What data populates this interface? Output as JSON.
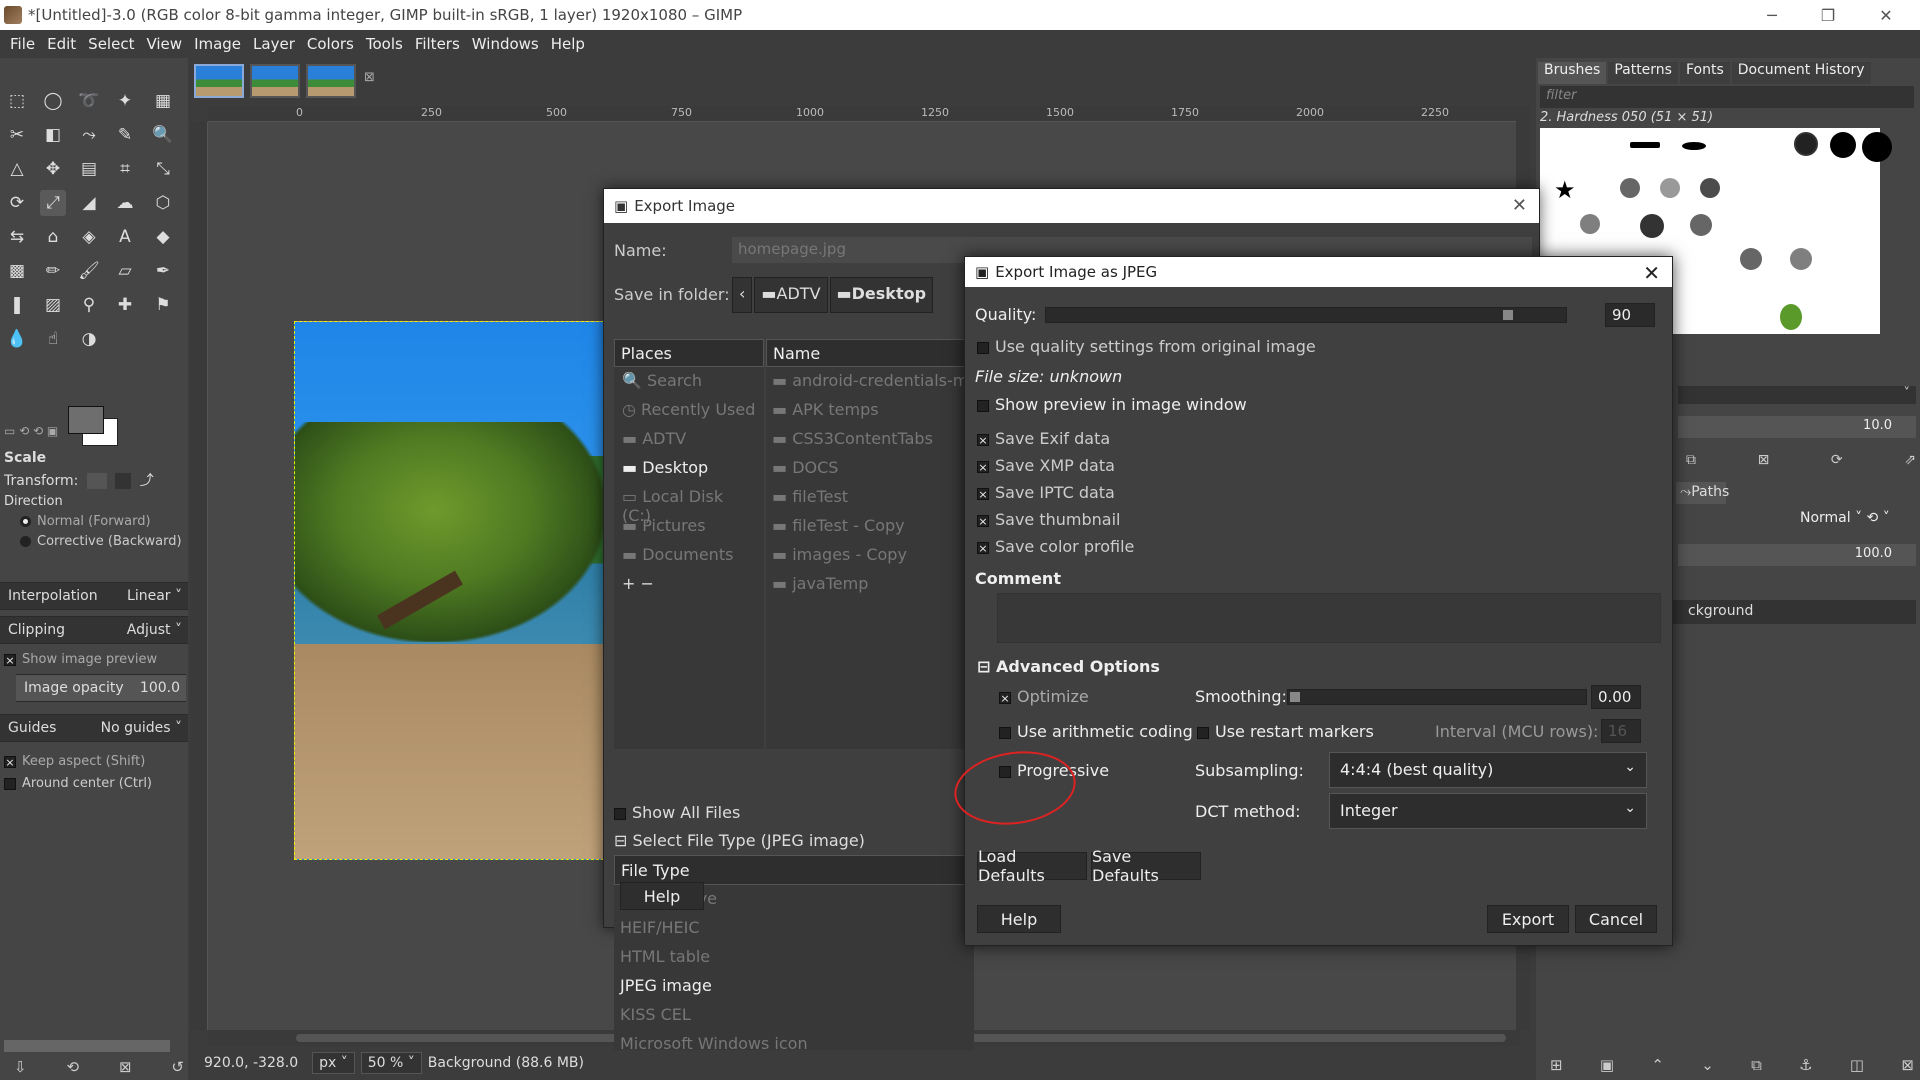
{
  "window": {
    "title": "*[Untitled]-3.0 (RGB color 8-bit gamma integer, GIMP built-in sRGB, 1 layer) 1920x1080 – GIMP"
  },
  "menu": [
    "File",
    "Edit",
    "Select",
    "View",
    "Image",
    "Layer",
    "Colors",
    "Tools",
    "Filters",
    "Windows",
    "Help"
  ],
  "tool_options": {
    "title": "Scale",
    "transform_label": "Transform:",
    "direction_label": "Direction",
    "direction_normal": "Normal (Forward)",
    "direction_corrective": "Corrective (Backward)",
    "interpolation_label": "Interpolation",
    "interpolation_value": "Linear",
    "clipping_label": "Clipping",
    "clipping_value": "Adjust",
    "show_preview": "Show image preview",
    "image_opacity_label": "Image opacity",
    "image_opacity_value": "100.0",
    "guides_label": "Guides",
    "guides_value": "No guides",
    "keep_aspect": "Keep aspect (Shift)",
    "around_center": "Around center (Ctrl)"
  },
  "ruler": {
    "ticks": [
      "0",
      "250",
      "500",
      "750",
      "1000",
      "1250",
      "1500",
      "1750",
      "2000",
      "2250"
    ]
  },
  "status": {
    "coords": "920.0, -328.0",
    "unit": "px",
    "zoom": "50 %",
    "layer_info": "Background (88.6 MB)"
  },
  "dock": {
    "tabs": [
      "Brushes",
      "Patterns",
      "Fonts",
      "Document History"
    ],
    "filter_placeholder": "filter",
    "brush_name": "2. Hardness 050 (51 × 51)",
    "spacing_value": "10.0",
    "paths_tab": "Paths",
    "mode_value": "Normal",
    "opacity_value": "100.0",
    "layer_name": "ckground"
  },
  "export_dialog": {
    "title": "Export Image",
    "name_label": "Name:",
    "name_value": "homepage.jpg",
    "save_in_label": "Save in folder:",
    "path": [
      "ADTV",
      "Desktop"
    ],
    "places_header": "Places",
    "places": [
      "Search",
      "Recently Used",
      "ADTV",
      "Desktop",
      "Local Disk (C:)",
      "Pictures",
      "Documents"
    ],
    "name_header": "Name",
    "files": [
      "android-credentials-mas",
      "APK temps",
      "CSS3ContentTabs",
      "DOCS",
      "fileTest",
      "fileTest - Copy",
      "images - Copy",
      "javaTemp"
    ],
    "show_all_files": "Show All Files",
    "select_file_type": "Select File Type (JPEG image)",
    "file_type_header": "File Type",
    "file_types": [
      "gzip archive",
      "HEIF/HEIC",
      "HTML table",
      "JPEG image",
      "KISS CEL",
      "Microsoft Windows icon"
    ],
    "help_button": "Help"
  },
  "jpeg_dialog": {
    "title": "Export Image as JPEG",
    "quality_label": "Quality:",
    "quality_value": "90",
    "quality_fraction": 0.9,
    "use_quality": "Use quality settings from original image",
    "file_size": "File size: unknown",
    "show_preview": "Show preview in image window",
    "save_exif": "Save Exif data",
    "save_xmp": "Save XMP data",
    "save_iptc": "Save IPTC data",
    "save_thumbnail": "Save thumbnail",
    "save_color_profile": "Save color profile",
    "comment_label": "Comment",
    "advanced_label": "Advanced Options",
    "optimize": "Optimize",
    "smoothing_label": "Smoothing:",
    "smoothing_value": "0.00",
    "arithmetic": "Use arithmetic coding",
    "restart_markers": "Use restart markers",
    "interval_label": "Interval (MCU rows):",
    "interval_value": "16",
    "progressive": "Progressive",
    "subsampling_label": "Subsampling:",
    "subsampling_value": "4:4:4 (best quality)",
    "dct_label": "DCT method:",
    "dct_value": "Integer",
    "load_defaults": "Load Defaults",
    "save_defaults": "Save Defaults",
    "help": "Help",
    "export": "Export",
    "cancel": "Cancel"
  },
  "colors": {
    "annotation": "#dd2222",
    "selection_border": "#eeee00"
  }
}
